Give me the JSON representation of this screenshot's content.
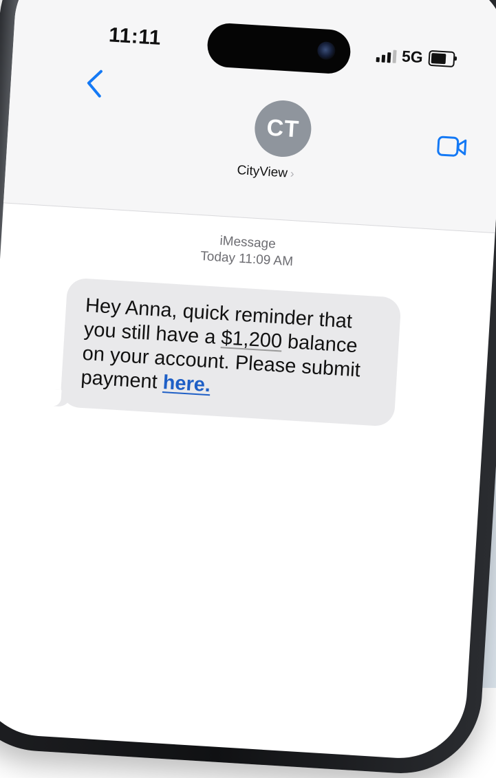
{
  "status_bar": {
    "time": "11:11",
    "network": "5G",
    "signal_bars": 3,
    "battery_level": 0.72
  },
  "header": {
    "back_icon": "chevron-left-icon",
    "avatar_initials": "CT",
    "contact_name": "CityView",
    "contact_chevron": "›",
    "video_icon": "video-camera-icon"
  },
  "conversation": {
    "service": "iMessage",
    "timestamp_day": "Today",
    "timestamp_time": "11:09 AM",
    "message": {
      "before_amount": "Hey Anna, quick reminder that you still have a ",
      "amount": "$1,200",
      "after_amount": " balance on your account. Please submit payment ",
      "link_text": "here."
    }
  },
  "colors": {
    "accent": "#1479f5",
    "link": "#1e5fc6",
    "bubble": "#e9e9eb",
    "avatar": "#8f959d"
  }
}
